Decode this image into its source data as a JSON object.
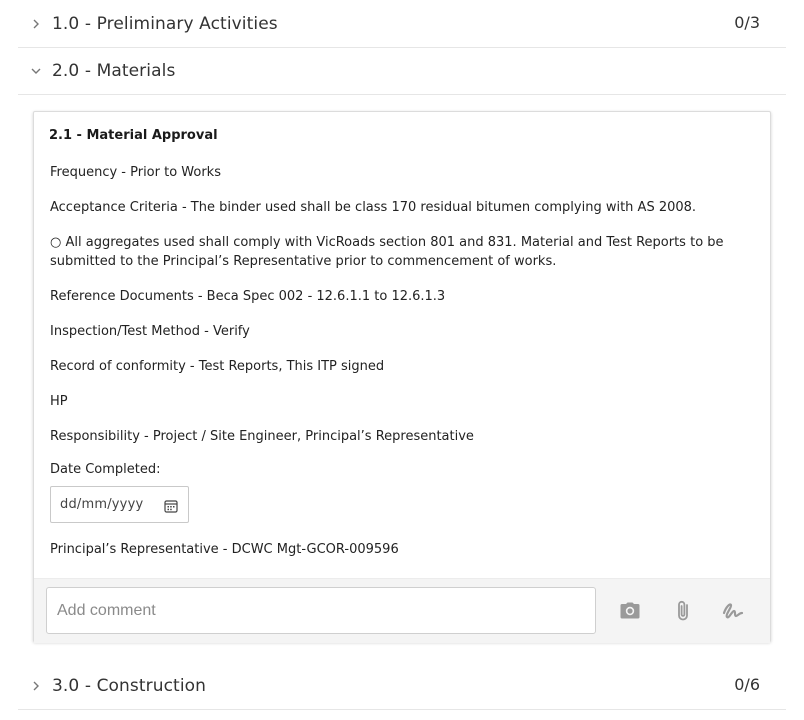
{
  "sections": [
    {
      "title": "1.0 - Preliminary Activities",
      "count": "0/3",
      "expanded": false
    },
    {
      "title": "2.0 - Materials",
      "count": "",
      "expanded": true
    },
    {
      "title": "3.0 - Construction",
      "count": "0/6",
      "expanded": false
    }
  ],
  "item": {
    "title": "2.1 - Material Approval",
    "lines": [
      "Frequency - Prior to Works",
      "Acceptance Criteria - The binder used shall be class 170 residual bitumen complying with AS 2008.",
      "○ All aggregates used shall comply with VicRoads section 801 and 831. Material and Test Reports to be submitted to the Principal’s Representative prior to commencement of works.",
      "Reference Documents - Beca Spec 002 - 12.6.1.1 to 12.6.1.3",
      "Inspection/Test Method - Verify",
      "Record of conformity - Test Reports, This ITP signed",
      "HP",
      "Responsibility - Project / Site Engineer, Principal’s Representative"
    ],
    "date_label": "Date Completed:",
    "date_placeholder": "dd/mm/yyyy",
    "representative": "Principal’s Representative - DCWC Mgt-GCOR-009596"
  },
  "footer": {
    "comment_placeholder": "Add comment",
    "icons": [
      "camera-icon",
      "paperclip-icon",
      "signature-icon"
    ]
  },
  "colors": {
    "icon_gray": "#9a9a9a",
    "divider": "#e6e6e6",
    "footer_bg": "#f4f4f4"
  }
}
